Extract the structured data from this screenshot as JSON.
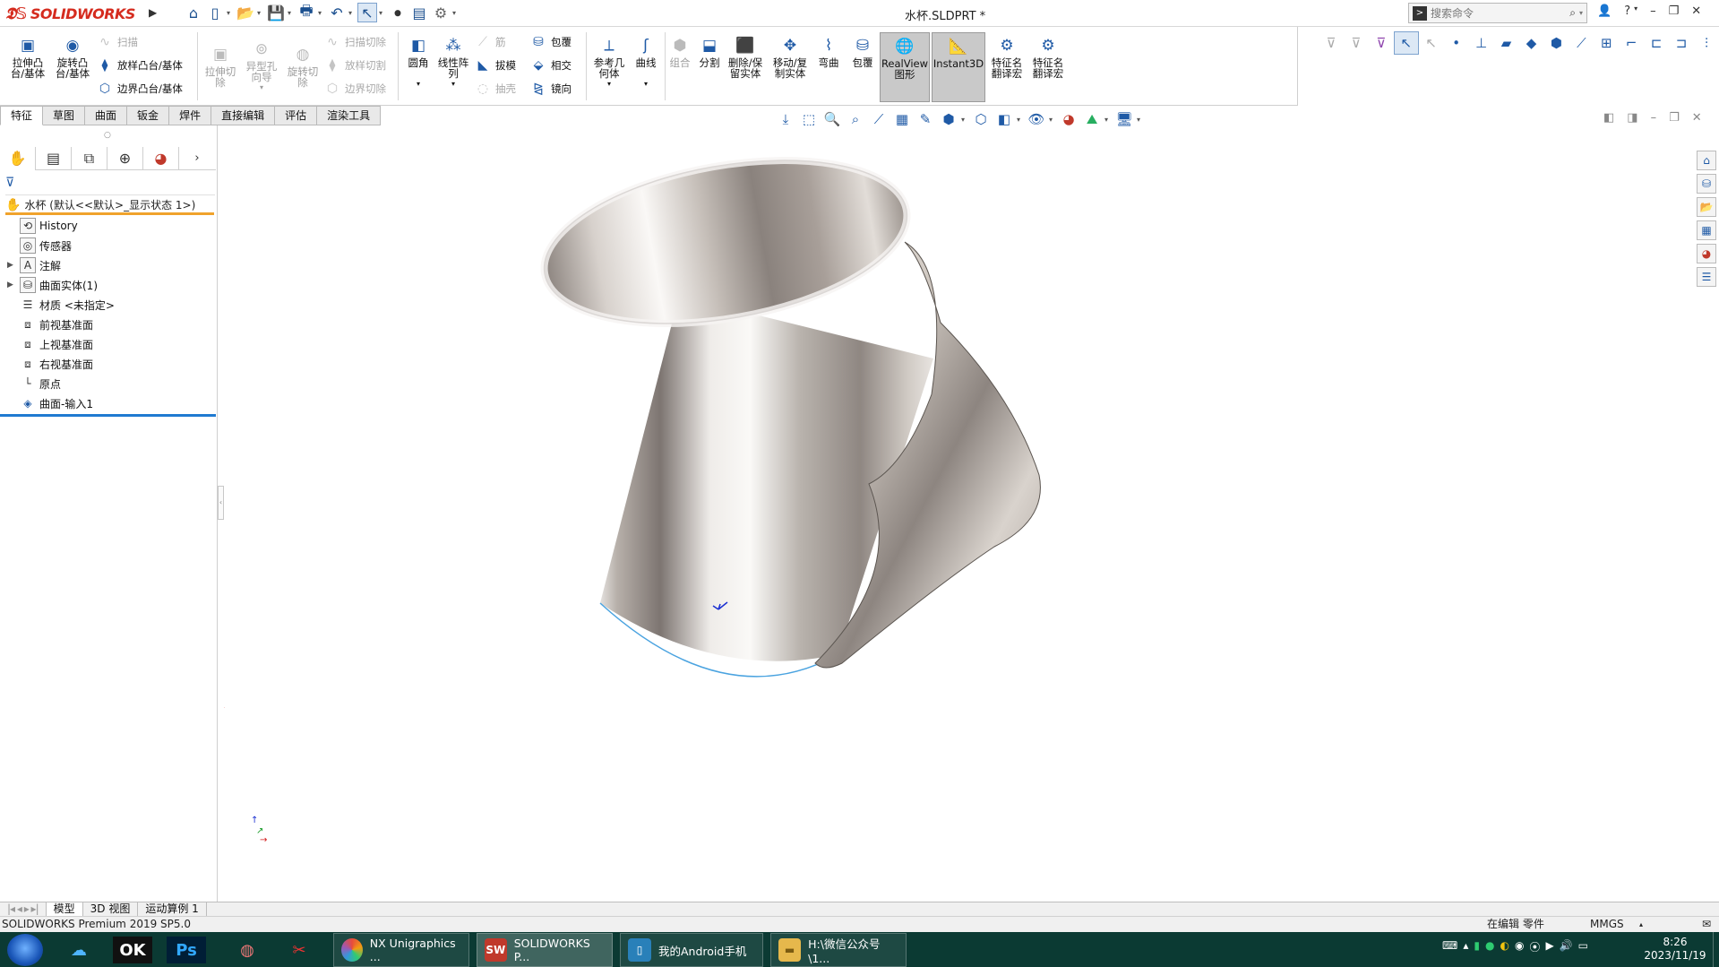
{
  "titlebar": {
    "brand": "SOLIDWORKS",
    "window_title": "水杯.SLDPRT *",
    "search_placeholder": "搜索命令",
    "quick_icons": [
      "home-icon",
      "new-doc-icon",
      "open-folder-icon",
      "save-icon",
      "print-icon",
      "undo-icon",
      "select-arrow-icon",
      "traffic-light-icon",
      "file-props-icon",
      "options-gear-icon"
    ]
  },
  "ribbon": {
    "extrude_boss": "拉伸凸\n台/基体",
    "revolve_boss": "旋转凸\n台/基体",
    "sweep": "扫描",
    "loft": "放样凸台/基体",
    "boundary": "边界凸台/基体",
    "extrude_cut": "拉伸切\n除",
    "hole_wizard": "异型孔\n向导",
    "revolve_cut": "旋转切\n除",
    "sweep_cut": "扫描切除",
    "loft_cut": "放样切割",
    "boundary_cut": "边界切除",
    "fillet": "圆角",
    "linear_pattern": "线性阵\n列",
    "rib": "筋",
    "draft": "拔模",
    "shell": "抽壳",
    "wrap": "包覆",
    "intersect": "相交",
    "mirror": "镜向",
    "ref_geometry": "参考几\n何体",
    "curves": "曲线",
    "combine": "组合",
    "split": "分割",
    "delete_body": "删除/保\n留实体",
    "move_body": "移动/复\n制实体",
    "flex": "弯曲",
    "wrap2": "包覆",
    "realview": "RealView\n图形",
    "instant3d": "Instant3D",
    "translate1": "特征名\n翻译宏",
    "translate2": "特征名\n翻译宏"
  },
  "tabs": [
    "特征",
    "草图",
    "曲面",
    "钣金",
    "焊件",
    "直接编辑",
    "评估",
    "渲染工具"
  ],
  "active_tab": "特征",
  "tree": {
    "root": "水杯 (默认<<默认>_显示状态 1>)",
    "items": [
      {
        "label": "History",
        "icon": "history-icon",
        "expandable": false
      },
      {
        "label": "传感器",
        "icon": "sensor-icon",
        "expandable": false
      },
      {
        "label": "注解",
        "icon": "annotation-icon",
        "expandable": true
      },
      {
        "label": "曲面实体(1)",
        "icon": "surface-bodies-icon",
        "expandable": true
      },
      {
        "label": "材质 <未指定>",
        "icon": "material-icon",
        "expandable": false
      },
      {
        "label": "前视基准面",
        "icon": "plane-icon",
        "expandable": false
      },
      {
        "label": "上视基准面",
        "icon": "plane-icon",
        "expandable": false
      },
      {
        "label": "右视基准面",
        "icon": "plane-icon",
        "expandable": false
      },
      {
        "label": "原点",
        "icon": "origin-icon",
        "expandable": false
      },
      {
        "label": "曲面-输入1",
        "icon": "surface-import-icon",
        "expandable": false
      }
    ]
  },
  "bottom_tabs": [
    "模型",
    "3D 视图",
    "运动算例 1"
  ],
  "status": {
    "left": "SOLIDWORKS Premium 2019 SP5.0",
    "editing": "在编辑 零件",
    "units": "MMGS"
  },
  "taskbar": {
    "tasks": [
      {
        "label": "NX Unigraphics ...",
        "color": "#f39c12"
      },
      {
        "label": "SOLIDWORKS P...",
        "color": "#c0392b"
      },
      {
        "label": "我的Android手机",
        "color": "#2980b9"
      },
      {
        "label": "H:\\微信公众号\\1...",
        "color": "#e6b84c"
      }
    ],
    "time": "8:26",
    "date": "2023/11/19"
  },
  "colors": {
    "accent": "#1f5aa6",
    "brand": "#d52b1e",
    "taskbar": "#0b3a33",
    "tree_highlight": "#f0a32c"
  }
}
